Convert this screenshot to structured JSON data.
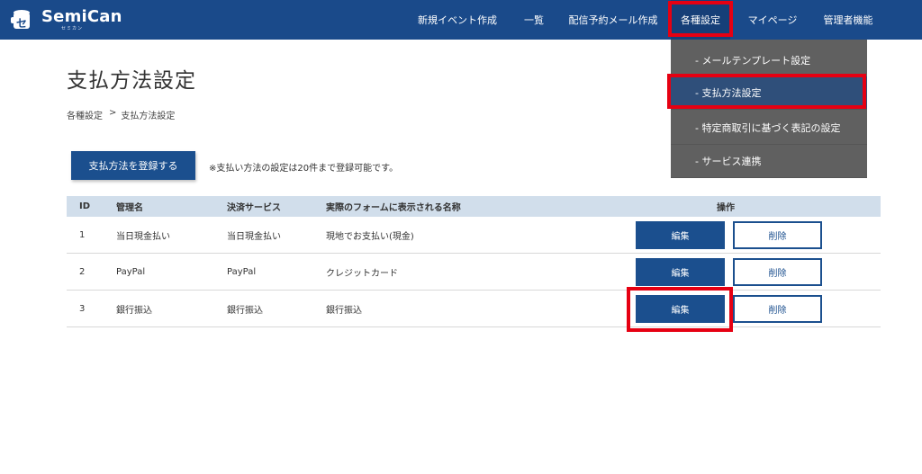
{
  "header": {
    "logo": {
      "title": "SemiCan",
      "sub": "セミカン"
    },
    "nav": [
      {
        "label": "新規イベント作成"
      },
      {
        "label": "一覧"
      },
      {
        "label": "配信予約メール作成"
      },
      {
        "label": "各種設定"
      },
      {
        "label": "マイページ"
      },
      {
        "label": "管理者機能"
      }
    ]
  },
  "dropdown": {
    "items": [
      {
        "label": "- メールテンプレート設定"
      },
      {
        "label": "- 支払方法設定"
      },
      {
        "label": "- 特定商取引に基づく表記の設定"
      },
      {
        "label": "- サービス連携"
      }
    ]
  },
  "page": {
    "title": "支払方法設定",
    "breadcrumb": {
      "parent": "各種設定",
      "separator": ">",
      "current": "支払方法設定"
    },
    "register_button": "支払方法を登録する",
    "register_note": "※支払い方法の設定は20件まで登録可能です。"
  },
  "table": {
    "headers": {
      "id": "ID",
      "name": "管理名",
      "service": "決済サービス",
      "display_name": "実際のフォームに表示される名称",
      "actions": "操作"
    },
    "rows": [
      {
        "id": "1",
        "name": "当日現金払い",
        "service": "当日現金払い",
        "display_name": "現地でお支払い(現金)",
        "edit": "編集",
        "delete": "削除"
      },
      {
        "id": "2",
        "name": "PayPal",
        "service": "PayPal",
        "display_name": "クレジットカード",
        "edit": "編集",
        "delete": "削除"
      },
      {
        "id": "3",
        "name": "銀行振込",
        "service": "銀行振込",
        "display_name": "銀行振込",
        "edit": "編集",
        "delete": "削除"
      }
    ]
  },
  "colors": {
    "header_bg": "#1a4a8a",
    "primary_button": "#1b4f8e",
    "dropdown_bg": "#606060",
    "highlight": "#e60012",
    "table_header_bg": "#d1deeb"
  }
}
